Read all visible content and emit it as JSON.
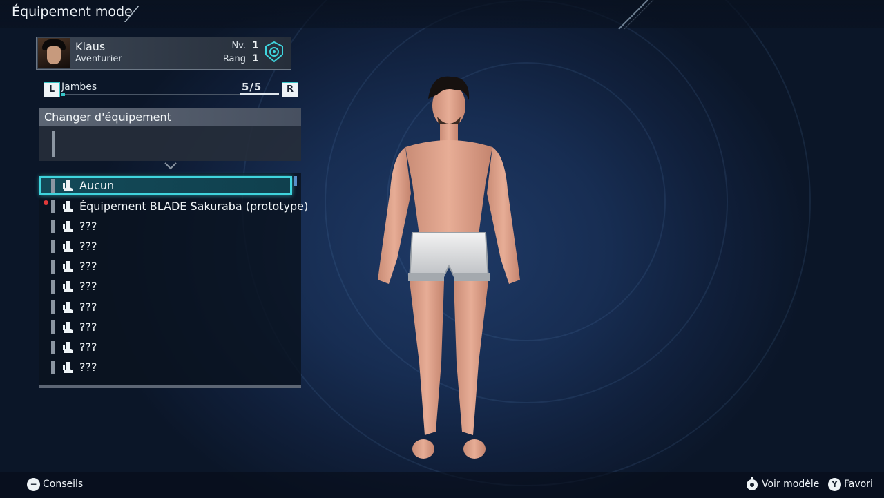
{
  "header": {
    "title": "Équipement mode"
  },
  "character": {
    "name": "Klaus",
    "class": "Aventurier",
    "level_label": "Nv.",
    "level": "1",
    "rank_label": "Rang",
    "rank": "1"
  },
  "slot": {
    "prev_key": "L",
    "next_key": "R",
    "name": "Jambes",
    "count": "5/5"
  },
  "panel": {
    "title": "Changer d'équipement",
    "items": [
      {
        "label": "Aucun",
        "selected": true,
        "new": false,
        "icon": "leg-armor-icon"
      },
      {
        "label": "Équipement BLADE Sakuraba (prototype)",
        "selected": false,
        "new": true,
        "icon": "leg-armor-icon"
      },
      {
        "label": "???",
        "selected": false,
        "new": false,
        "icon": "leg-armor-icon"
      },
      {
        "label": "???",
        "selected": false,
        "new": false,
        "icon": "leg-armor-icon"
      },
      {
        "label": "???",
        "selected": false,
        "new": false,
        "icon": "leg-armor-icon"
      },
      {
        "label": "???",
        "selected": false,
        "new": false,
        "icon": "leg-armor-icon"
      },
      {
        "label": "???",
        "selected": false,
        "new": false,
        "icon": "leg-armor-icon"
      },
      {
        "label": "???",
        "selected": false,
        "new": false,
        "icon": "leg-armor-icon"
      },
      {
        "label": "???",
        "selected": false,
        "new": false,
        "icon": "leg-armor-icon"
      },
      {
        "label": "???",
        "selected": false,
        "new": false,
        "icon": "leg-armor-icon"
      }
    ]
  },
  "footer": {
    "tips_key": "−",
    "tips_label": "Conseils",
    "view_icon": "right-stick-icon",
    "view_label": "Voir modèle",
    "fav_key": "Y",
    "fav_label": "Favori"
  },
  "colors": {
    "accent": "#3fd4dd",
    "selected_fill": "#134a58",
    "new_indicator": "#e23a3a",
    "background": "#172d52"
  }
}
